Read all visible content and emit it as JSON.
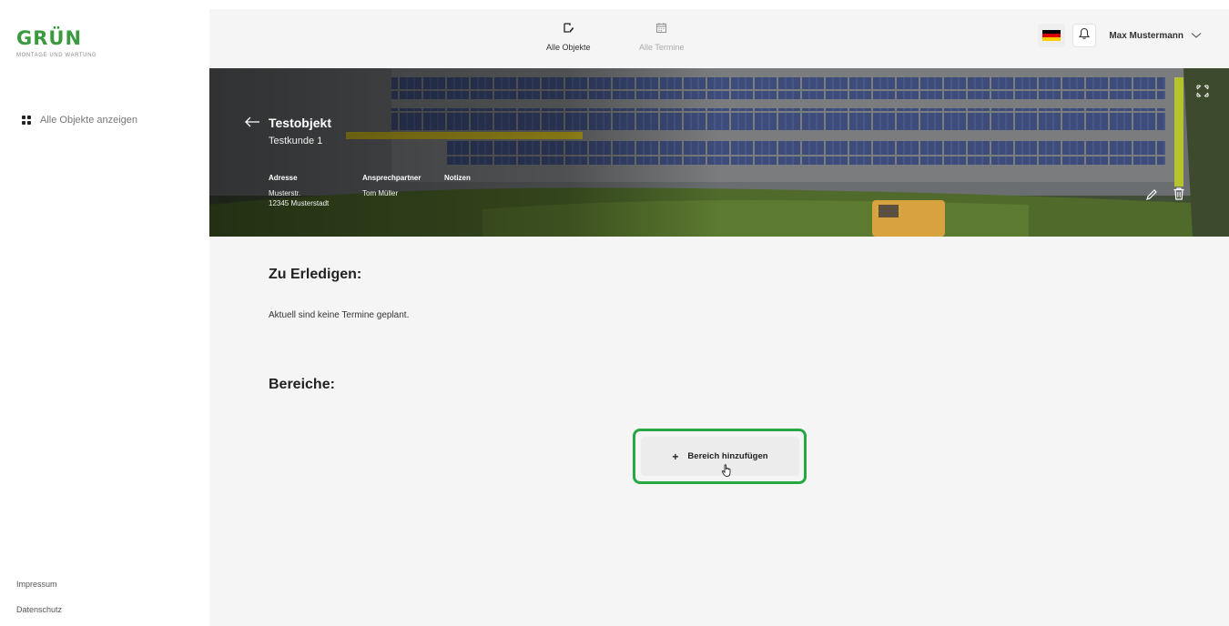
{
  "brand": {
    "name": "GRÜN",
    "tagline": "MONTAGE UND WARTUNG",
    "color": "#3a9a3f"
  },
  "sidebar": {
    "items": [
      {
        "label": "Alle Objekte anzeigen",
        "icon": "grid-icon"
      }
    ],
    "footer": {
      "impressum": "Impressum",
      "datenschutz": "Datenschutz"
    }
  },
  "topnav": {
    "tabs": [
      {
        "label": "Alle Objekte",
        "icon": "objects-icon",
        "active": true
      },
      {
        "label": "Alle Termine",
        "icon": "calendar-icon",
        "active": false
      }
    ]
  },
  "user": {
    "name": "Max Mustermann",
    "language_flag": "de-flag-icon"
  },
  "object": {
    "title": "Testobjekt",
    "customer": "Testkunde 1",
    "address_label": "Adresse",
    "address_line1": "Musterstr.",
    "address_line2": "12345 Musterstadt",
    "contact_label": "Ansprechpartner",
    "contact_name": "Tom Müller",
    "notes_label": "Notizen"
  },
  "todo": {
    "title": "Zu Erledigen:",
    "empty": "Aktuell sind keine Termine geplant."
  },
  "areas": {
    "title": "Bereiche:",
    "add_label": "Bereich hinzufügen",
    "add_icon": "+"
  },
  "colors": {
    "highlight": "#27a844",
    "main_bg": "#f5f5f5"
  }
}
